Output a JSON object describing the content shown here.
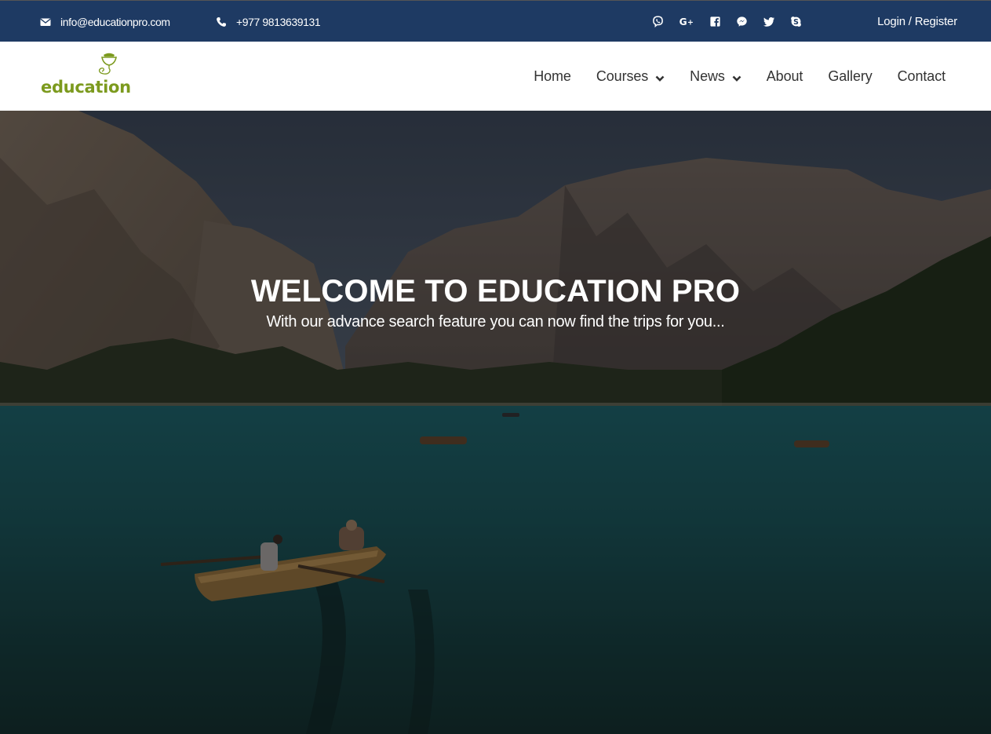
{
  "topbar": {
    "email": "info@educationpro.com",
    "phone": "+977 9813639131",
    "social": [
      {
        "name": "viber-icon",
        "label": "Viber"
      },
      {
        "name": "google-plus-icon",
        "label": "Google+"
      },
      {
        "name": "facebook-icon",
        "label": "Facebook"
      },
      {
        "name": "messenger-icon",
        "label": "Messenger"
      },
      {
        "name": "twitter-icon",
        "label": "Twitter"
      },
      {
        "name": "skype-icon",
        "label": "Skype"
      }
    ],
    "login_label": "Login / Register"
  },
  "header": {
    "logo_text": "education",
    "nav": [
      {
        "label": "Home",
        "dropdown": false
      },
      {
        "label": "Courses",
        "dropdown": true
      },
      {
        "label": "News",
        "dropdown": true
      },
      {
        "label": "About",
        "dropdown": false
      },
      {
        "label": "Gallery",
        "dropdown": false
      },
      {
        "label": "Contact",
        "dropdown": false
      }
    ]
  },
  "hero": {
    "title": "WELCOME TO EDUCATION PRO",
    "subtitle": "With our advance search feature you can now find the trips for you..."
  },
  "colors": {
    "topbar_bg": "#1e3a63",
    "logo_green": "#7c9a1e",
    "nav_text": "#333333"
  }
}
